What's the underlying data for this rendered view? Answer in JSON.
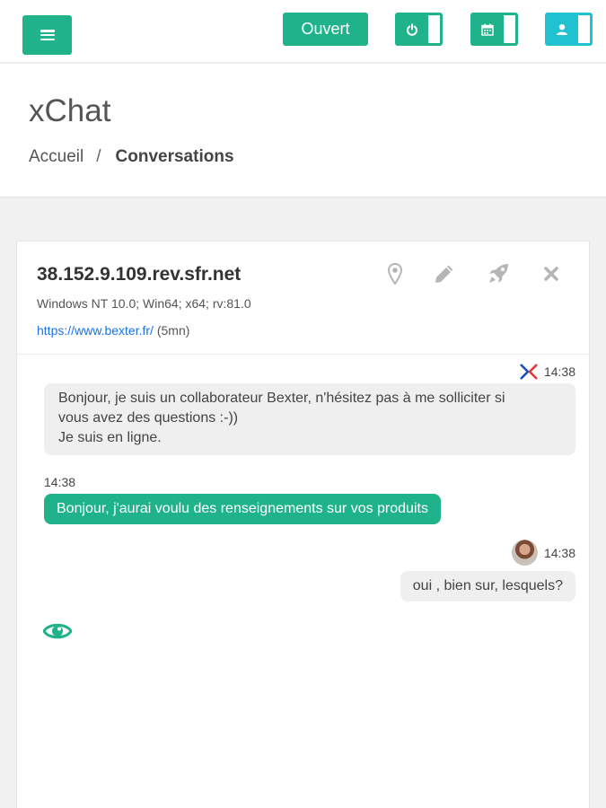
{
  "topbar": {
    "menu_icon": "hamburger-icon",
    "status_label": "Ouvert",
    "toggles": [
      {
        "icon": "power-icon",
        "color": "#1fb28b"
      },
      {
        "icon": "calendar-icon",
        "color": "#1fb28b"
      },
      {
        "icon": "agent-icon",
        "color": "#20c2cf"
      }
    ]
  },
  "header": {
    "title": "xChat",
    "breadcrumb": {
      "home": "Accueil",
      "separator": "/",
      "current": "Conversations"
    }
  },
  "conversation": {
    "host": "38.152.9.109.rev.sfr.net",
    "user_agent": "Windows NT 10.0; Win64; x64; rv:81.0",
    "url": "https://www.bexter.fr/",
    "duration": "(5mn)",
    "actions": [
      "location-pin-icon",
      "pencil-icon",
      "rocket-icon",
      "close-icon"
    ],
    "messages": [
      {
        "side": "agent",
        "time": "14:38",
        "lines": [
          "Bonjour, je suis un collaborateur Bexter, n'hésitez pas à me solliciter si",
          "vous avez des questions :-))",
          "Je suis en ligne."
        ]
      },
      {
        "side": "visitor",
        "time": "14:38",
        "text": "Bonjour, j'aurai voulu des renseignements sur vos produits"
      },
      {
        "side": "agent",
        "time": "14:38",
        "text": "oui , bien sur, lesquels?"
      }
    ],
    "seen_icon": "eye-icon"
  },
  "colors": {
    "accent": "#1fb28b",
    "teal": "#20c2cf",
    "link": "#1a73e8"
  }
}
